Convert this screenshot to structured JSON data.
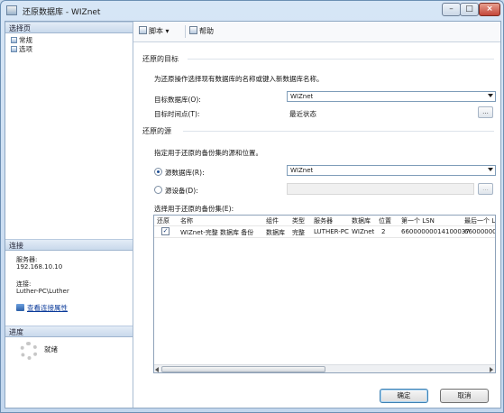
{
  "window": {
    "title": "还原数据库 - WIZnet"
  },
  "left": {
    "select_page_header": "选择页",
    "pages": [
      "常规",
      "选项"
    ],
    "connection_header": "连接",
    "server_label": "服务器:",
    "server_value": "192.168.10.10",
    "connection_label": "连接:",
    "connection_value": "Luther-PC\\Luther",
    "view_connection_link": "查看连接属性",
    "progress_header": "进度",
    "progress_status": "就绪"
  },
  "toolbar": {
    "script_label": "脚本",
    "help_label": "帮助"
  },
  "target": {
    "group_label": "还原的目标",
    "instruction": "为还原操作选择现有数据库的名称或键入新数据库名称。",
    "target_db_label": "目标数据库(O):",
    "target_db_value": "WIZnet",
    "target_time_label": "目标时间点(T):",
    "target_time_value": "最近状态",
    "ellipsis": "..."
  },
  "source": {
    "group_label": "还原的源",
    "instruction": "指定用于还原的备份集的源和位置。",
    "from_db_label": "源数据库(R):",
    "from_db_value": "WIZnet",
    "from_device_label": "源设备(D):",
    "backup_sets_label": "选择用于还原的备份集(E):",
    "columns": [
      "还原",
      "名称",
      "组件",
      "类型",
      "服务器",
      "数据库",
      "位置",
      "第一个 LSN",
      "最后一个 L"
    ],
    "rows": [
      {
        "restore_checked": true,
        "check_glyph": "✓",
        "name": "WIZnet-完整 数据库 备份",
        "component": "数据库",
        "type": "完整",
        "server": "LUTHER-PC",
        "database": "WIZnet",
        "position": "2",
        "first_lsn": "66000000014100037",
        "last_lsn": "660000000"
      }
    ]
  },
  "buttons": {
    "ok": "确定",
    "cancel": "取消"
  }
}
